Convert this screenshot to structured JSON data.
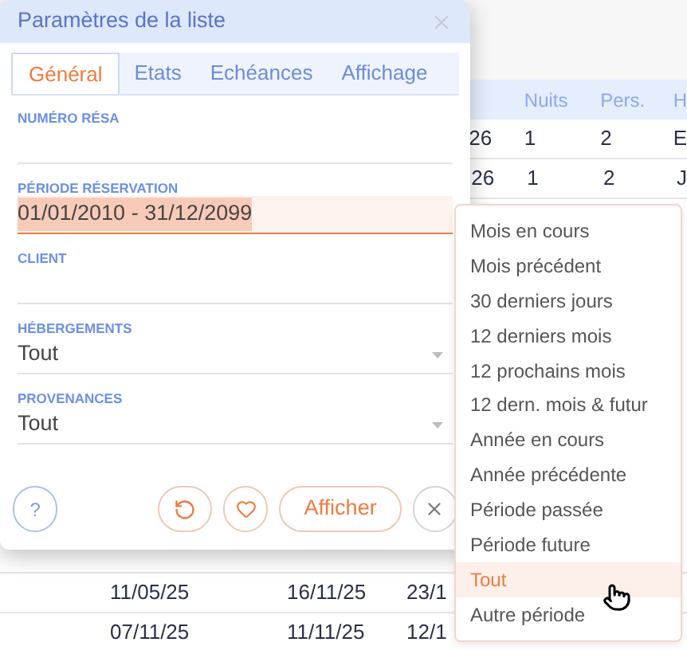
{
  "background_table": {
    "columns": [
      "Nuits",
      "Pers.",
      "H"
    ],
    "top_rows": [
      {
        "cells": [
          "26",
          "1",
          "2",
          "E"
        ]
      },
      {
        "cells": [
          "26",
          "1",
          "2",
          "J"
        ]
      }
    ],
    "bottom_rows": [
      {
        "cells": [
          "11/05/25",
          "16/11/25",
          "23/1"
        ]
      },
      {
        "cells": [
          "07/11/25",
          "11/11/25",
          "12/1"
        ]
      }
    ]
  },
  "dialog": {
    "title": "Paramètres de la liste",
    "tabs": [
      {
        "label": "Général",
        "selected": true
      },
      {
        "label": "Etats",
        "selected": false
      },
      {
        "label": "Echéances",
        "selected": false
      },
      {
        "label": "Affichage",
        "selected": false
      }
    ],
    "fields": [
      {
        "kind": "text",
        "label": "NUMÉRO RÉSA",
        "focused": false
      },
      {
        "kind": "text",
        "label": "PÉRIODE RÉSERVATION",
        "value": "01/01/2010 - 31/12/2099",
        "focused": true,
        "value_selected": true
      },
      {
        "kind": "text",
        "label": "CLIENT",
        "focused": false
      },
      {
        "kind": "select",
        "label": "HÉBERGEMENTS",
        "value": "Tout",
        "focused": false
      },
      {
        "kind": "select",
        "label": "PROVENANCES",
        "value": "Tout",
        "focused": false
      }
    ],
    "help_button": {
      "label": "?"
    },
    "apply_button": {
      "label": "Afficher"
    }
  },
  "period_menu": {
    "items": [
      {
        "label": "Mois en cours",
        "selected": false
      },
      {
        "label": "Mois précédent",
        "selected": false
      },
      {
        "label": "30 derniers jours",
        "selected": false
      },
      {
        "label": "12 derniers mois",
        "selected": false
      },
      {
        "label": "12 prochains mois",
        "selected": false
      },
      {
        "label": "12 dern. mois & futur",
        "selected": false
      },
      {
        "label": "Année en cours",
        "selected": false
      },
      {
        "label": "Année précédente",
        "selected": false
      },
      {
        "label": "Période passée",
        "selected": false
      },
      {
        "label": "Période future",
        "selected": false
      },
      {
        "label": "Tout",
        "selected": true
      },
      {
        "label": "Autre période",
        "selected": false
      }
    ]
  }
}
